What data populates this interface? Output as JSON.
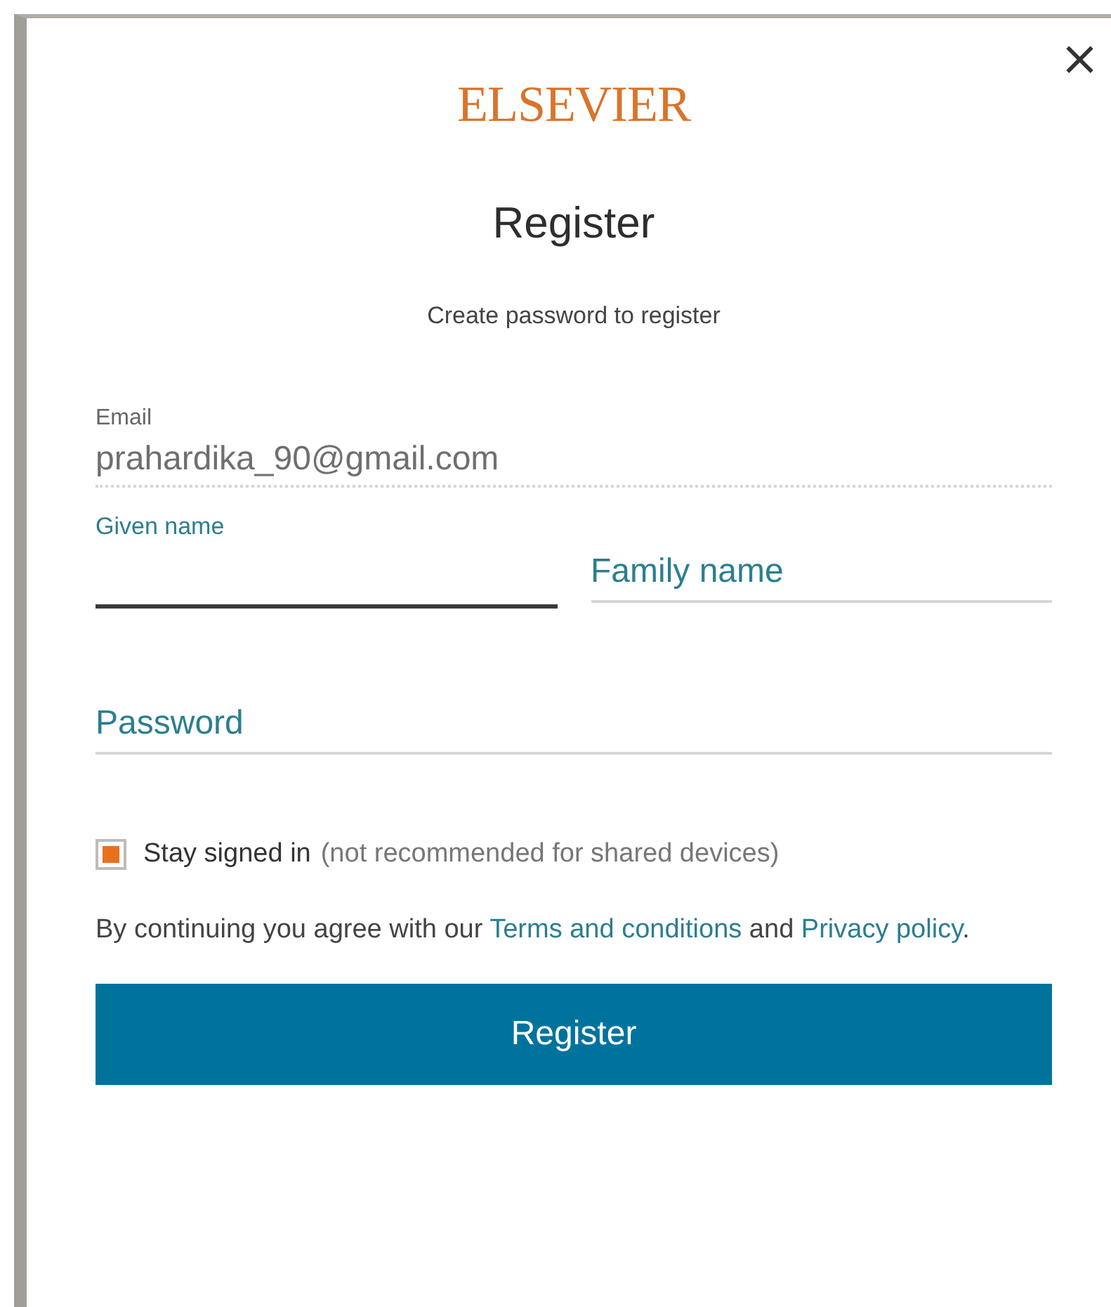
{
  "dialog": {
    "close_label": "×",
    "logo": "ELSEVIER",
    "title": "Register",
    "subtitle": "Create password to register"
  },
  "email": {
    "label": "Email",
    "value": "prahardika_90@gmail.com"
  },
  "name_fields": [
    {
      "label": "Given name",
      "focused": true
    },
    {
      "label": "Family name",
      "focused": false
    }
  ],
  "password": {
    "label": "Password",
    "focused": false
  },
  "stay_signed_in": {
    "label": "Stay signed in",
    "note": "(not recommended for shared devices)",
    "checked": true
  },
  "consent": {
    "before": "By continuing you agree with our",
    "terms_link": "Terms and conditions",
    "middle": "and",
    "privacy_link": "Privacy policy",
    "after": "."
  },
  "submit": {
    "label": "Register"
  }
}
